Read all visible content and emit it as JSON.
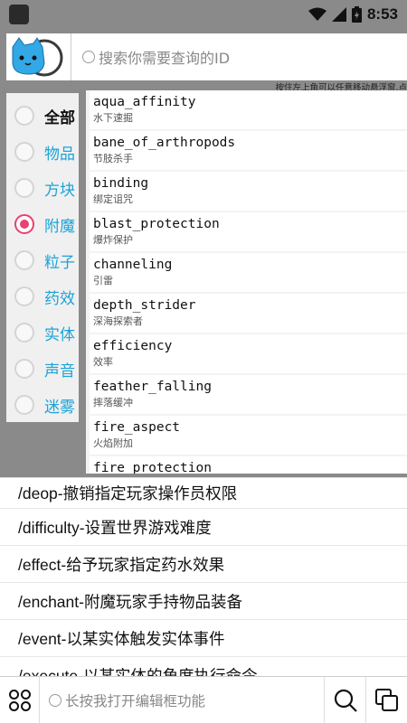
{
  "status": {
    "time": "8:53"
  },
  "search": {
    "placeholder": "搜索你需要查询的ID",
    "hint": "按住左上角可以任意移动悬浮窗,点"
  },
  "categories": [
    {
      "label": "全部",
      "selected": false
    },
    {
      "label": "物品",
      "selected": false
    },
    {
      "label": "方块",
      "selected": false
    },
    {
      "label": "附魔",
      "selected": true
    },
    {
      "label": "粒子",
      "selected": false
    },
    {
      "label": "药效",
      "selected": false
    },
    {
      "label": "实体",
      "selected": false
    },
    {
      "label": "声音",
      "selected": false
    },
    {
      "label": "迷雾",
      "selected": false
    }
  ],
  "list": [
    {
      "id": "aqua_affinity",
      "name": "水下速掘"
    },
    {
      "id": "bane_of_arthropods",
      "name": "节肢杀手"
    },
    {
      "id": "binding",
      "name": "绑定诅咒"
    },
    {
      "id": "blast_protection",
      "name": "爆炸保护"
    },
    {
      "id": "channeling",
      "name": "引雷"
    },
    {
      "id": "depth_strider",
      "name": "深海探索者"
    },
    {
      "id": "efficiency",
      "name": "效率"
    },
    {
      "id": "feather_falling",
      "name": "摔落缓冲"
    },
    {
      "id": "fire_aspect",
      "name": "火焰附加"
    },
    {
      "id": "fire_protection",
      "name": ""
    }
  ],
  "commands": [
    "/deop-撤销指定玩家操作员权限",
    "/difficulty-设置世界游戏难度",
    "/effect-给予玩家指定药水效果",
    "/enchant-附魔玩家手持物品装备",
    "/event-以某实体触发实体事件",
    "/execute-以某实体的角度执行命令"
  ],
  "bottom": {
    "placeholder": "长按我打开编辑框功能"
  },
  "colors": {
    "accent": "#e74272",
    "category_text": "#1ba3d8",
    "background": "#8a8a8a"
  },
  "icons": [
    "app-icon",
    "wifi-icon",
    "signal-icon",
    "battery-icon",
    "cat-logo-icon",
    "grid-icon",
    "search-icon",
    "copy-icon"
  ]
}
